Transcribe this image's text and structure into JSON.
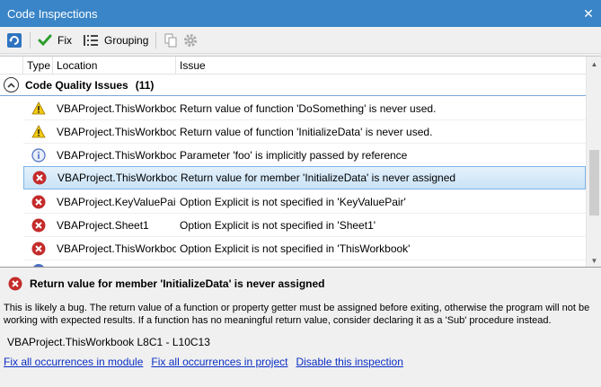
{
  "window": {
    "title": "Code Inspections",
    "close_glyph": "✕"
  },
  "toolbar": {
    "fix_label": "Fix",
    "grouping_label": "Grouping"
  },
  "columns": {
    "type": "Type",
    "location": "Location",
    "issue": "Issue"
  },
  "group": {
    "label": "Code Quality Issues",
    "count": "(11)"
  },
  "issues": [
    {
      "severity": "warning",
      "location": "VBAProject.ThisWorkbook",
      "description": "Return value of function 'DoSomething' is never used."
    },
    {
      "severity": "warning",
      "location": "VBAProject.ThisWorkbook",
      "description": "Return value of function 'InitializeData' is never used."
    },
    {
      "severity": "info",
      "location": "VBAProject.ThisWorkbook",
      "description": "Parameter 'foo' is implicitly passed by reference"
    },
    {
      "severity": "error",
      "location": "VBAProject.ThisWorkbook",
      "description": "Return value for member 'InitializeData' is never assigned",
      "selected": true
    },
    {
      "severity": "error",
      "location": "VBAProject.KeyValuePair",
      "description": "Option Explicit is not specified in 'KeyValuePair'"
    },
    {
      "severity": "error",
      "location": "VBAProject.Sheet1",
      "description": "Option Explicit is not specified in 'Sheet1'"
    },
    {
      "severity": "error",
      "location": "VBAProject.ThisWorkbook",
      "description": "Option Explicit is not specified in 'ThisWorkbook'"
    }
  ],
  "details": {
    "title": "Return value for member 'InitializeData' is never assigned",
    "description": "This is likely a bug. The return value of a function or property getter must be assigned before exiting, otherwise the program will not be working with expected results. If a function has no meaningful return value, consider declaring it as a 'Sub' procedure instead.",
    "location": "VBAProject.ThisWorkbook L8C1 - L10C13",
    "links": {
      "fix_module": "Fix all occurrences in module",
      "fix_project": "Fix all occurrences in project",
      "disable": "Disable this inspection"
    }
  },
  "colors": {
    "titlebar": "#3a85c7",
    "error": "#c42b2b",
    "warning": "#f2c811",
    "info": "#4a6fc4",
    "link": "#0a2ec4",
    "selection": "#c9e3f7"
  }
}
